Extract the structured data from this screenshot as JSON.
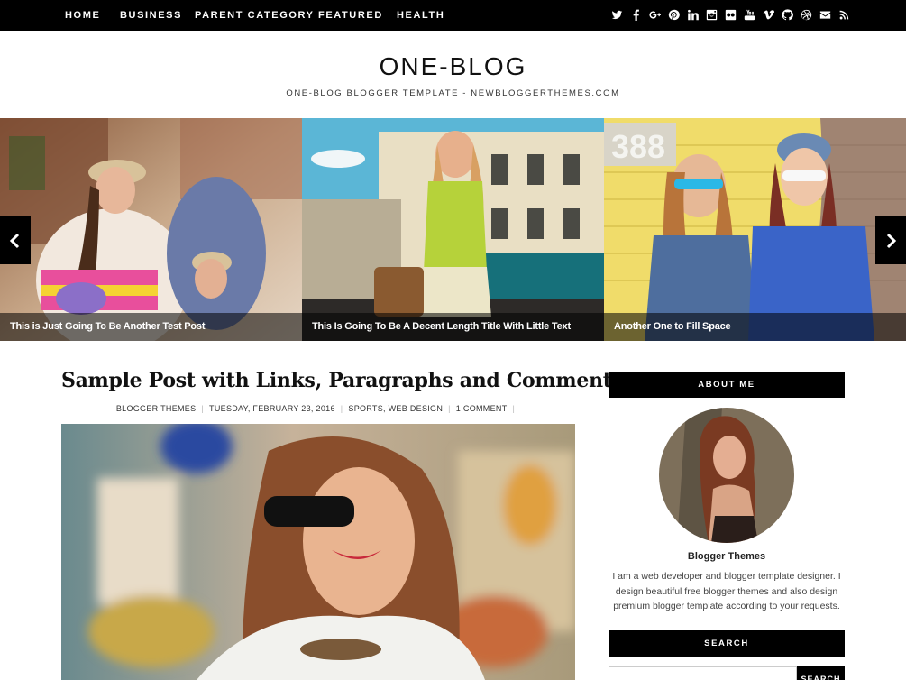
{
  "nav": {
    "items": [
      "HOME",
      "BUSINESS",
      "PARENT CATEGORY",
      "FEATURED",
      "HEALTH"
    ]
  },
  "social_icons": [
    "twitter-icon",
    "facebook-icon",
    "google-plus-icon",
    "pinterest-icon",
    "linkedin-icon",
    "instagram-icon",
    "flickr-icon",
    "youtube-icon",
    "vimeo-icon",
    "github-icon",
    "dribbble-icon",
    "email-icon",
    "rss-icon"
  ],
  "header": {
    "title": "ONE-BLOG",
    "description": "ONE-BLOG BLOGGER TEMPLATE - NEWBLOGGERTHEMES.COM"
  },
  "slider": {
    "slides": [
      {
        "caption": "This is Just Going To Be Another Test Post"
      },
      {
        "caption": "This Is Going To Be A Decent Length Title With Little Text"
      },
      {
        "caption": "Another One to Fill Space"
      }
    ]
  },
  "post": {
    "title": "Sample Post with Links, Paragraphs and Comments",
    "author": "BLOGGER THEMES",
    "date": "TUESDAY, FEBRUARY 23, 2016",
    "labels": "SPORTS, WEB DESIGN",
    "comments": "1 COMMENT"
  },
  "sidebar": {
    "about_heading": "ABOUT ME",
    "about_name": "Blogger Themes",
    "about_text": "I am a web developer and blogger template designer. I design beautiful free blogger themes and also design premium blogger template according to your requests.",
    "search_heading": "SEARCH",
    "search_button": "SEARCH",
    "search_placeholder": ""
  },
  "colors": {
    "nav_bg": "#000000",
    "accent": "#000000",
    "caption_bg": "rgba(0,0,0,0.55)"
  }
}
